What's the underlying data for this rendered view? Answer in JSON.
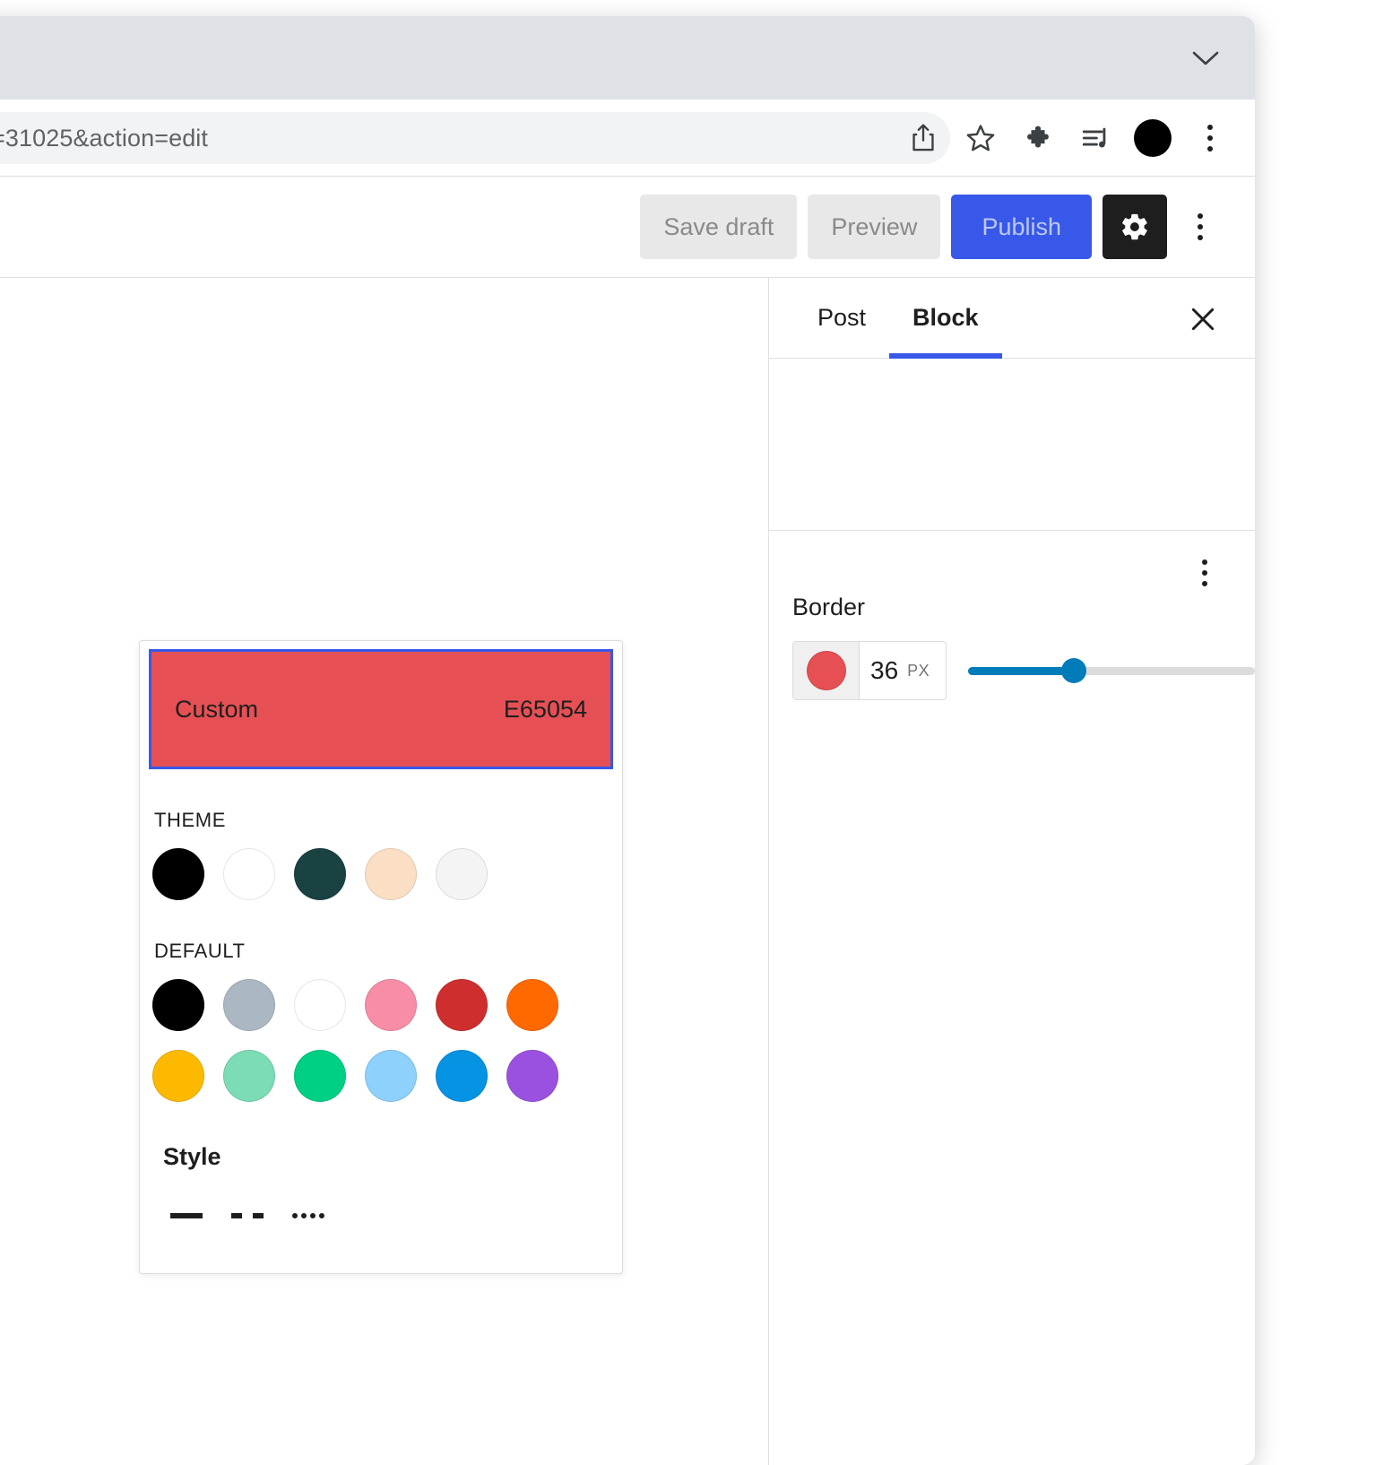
{
  "browser": {
    "url_text": "=31025&action=edit",
    "collapse_icon": "chevron-down-icon",
    "toolbar_icons": [
      {
        "name": "share-icon",
        "label": "Share"
      },
      {
        "name": "bookmark-star-icon",
        "label": "Bookmark"
      },
      {
        "name": "extensions-puzzle-icon",
        "label": "Extensions"
      },
      {
        "name": "media-playlist-icon",
        "label": "Media control"
      },
      {
        "name": "profile-avatar-icon",
        "label": "Profile"
      },
      {
        "name": "chrome-menu-kebab-icon",
        "label": "Customize and control"
      }
    ]
  },
  "editor_toolbar": {
    "save_draft_label": "Save draft",
    "preview_label": "Preview",
    "publish_label": "Publish",
    "settings_icon": "gear-icon",
    "options_icon": "vertical-kebab-icon",
    "publish_bg": "#3858e9",
    "settings_bg": "#1e1e1e"
  },
  "sidebar": {
    "tabs": [
      {
        "label": "Post",
        "active": false
      },
      {
        "label": "Block",
        "active": true
      }
    ],
    "close_icon": "close-x-icon",
    "active_underline_color": "#3858e9",
    "section": {
      "title": "Border",
      "kebab_icon": "vertical-kebab-icon",
      "color_swatch": "#e65054",
      "width_value": "36",
      "width_unit": "PX",
      "slider": {
        "percent": 37,
        "fill_color": "#007cba",
        "track_color": "#dcdcdc"
      }
    }
  },
  "color_popover": {
    "custom": {
      "label": "Custom",
      "hex": "E65054",
      "fill": "#e65054",
      "focus_border": "#3858e9"
    },
    "theme": {
      "title": "THEME",
      "swatches": [
        {
          "name": "theme-black",
          "hex": "#000000"
        },
        {
          "name": "theme-white",
          "hex": "#ffffff"
        },
        {
          "name": "theme-dark-teal",
          "hex": "#1b4242"
        },
        {
          "name": "theme-peach",
          "hex": "#fbdfc4"
        },
        {
          "name": "theme-off-white",
          "hex": "#f4f4f4"
        }
      ]
    },
    "default": {
      "title": "DEFAULT",
      "swatches": [
        {
          "name": "default-black",
          "hex": "#000000"
        },
        {
          "name": "default-cyan-bluish-gray",
          "hex": "#abb8c3"
        },
        {
          "name": "default-white",
          "hex": "#ffffff"
        },
        {
          "name": "default-pale-pink",
          "hex": "#f78da7"
        },
        {
          "name": "default-vivid-red",
          "hex": "#cf2e2e"
        },
        {
          "name": "default-luminous-orange",
          "hex": "#ff6900"
        },
        {
          "name": "default-luminous-amber",
          "hex": "#fcb900"
        },
        {
          "name": "default-light-green-cyan",
          "hex": "#7bdcb5"
        },
        {
          "name": "default-vivid-green-cyan",
          "hex": "#00d084"
        },
        {
          "name": "default-pale-cyan-blue",
          "hex": "#8ed1fc"
        },
        {
          "name": "default-vivid-cyan-blue",
          "hex": "#0693e3"
        },
        {
          "name": "default-vivid-purple",
          "hex": "#9b51e0"
        }
      ]
    },
    "style": {
      "title": "Style",
      "options": [
        {
          "name": "border-style-solid",
          "label": "Solid"
        },
        {
          "name": "border-style-dashed",
          "label": "Dashed"
        },
        {
          "name": "border-style-dotted",
          "label": "Dotted"
        }
      ]
    }
  }
}
